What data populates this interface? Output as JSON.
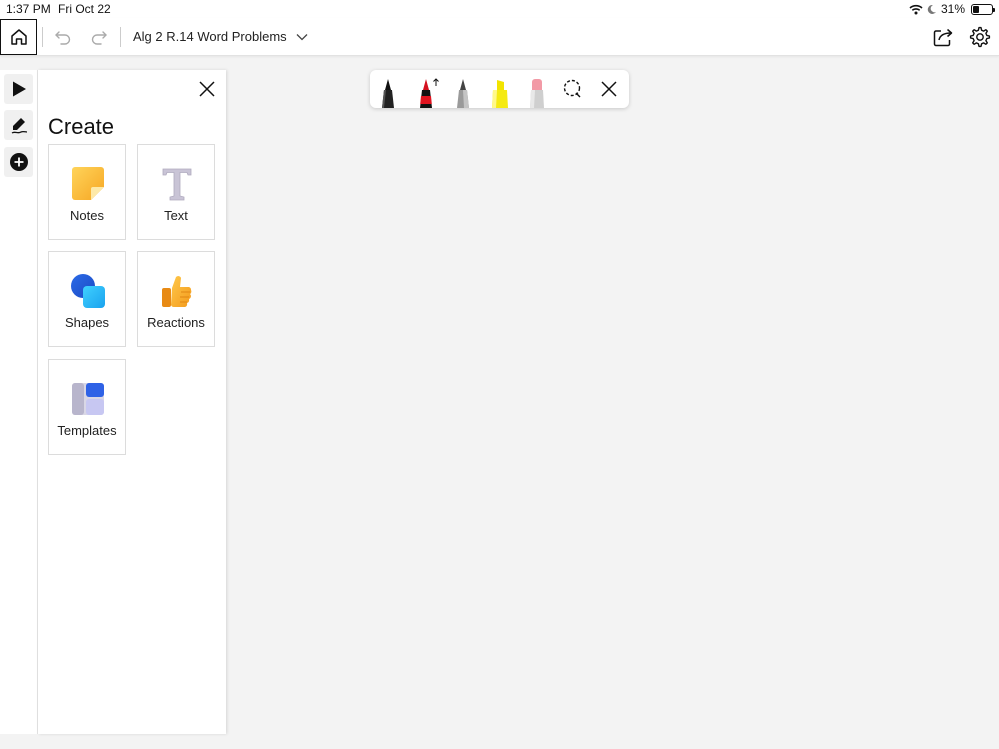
{
  "status": {
    "time": "1:37 PM",
    "date": "Fri Oct 22",
    "battery": "31%",
    "battery_level": 0.31
  },
  "toolbar": {
    "board_title": "Alg 2 R.14 Word Problems"
  },
  "create_panel": {
    "title": "Create",
    "tiles": [
      {
        "label": "Notes",
        "icon": "sticky-note-icon"
      },
      {
        "label": "Text",
        "icon": "text-icon"
      },
      {
        "label": "Shapes",
        "icon": "shapes-icon"
      },
      {
        "label": "Reactions",
        "icon": "thumbs-up-icon"
      },
      {
        "label": "Templates",
        "icon": "templates-icon"
      }
    ]
  },
  "ink_toolbar": {
    "tools": [
      "black-pen-icon",
      "red-pen-icon",
      "pencil-icon",
      "highlighter-icon",
      "eraser-icon",
      "lasso-icon",
      "close-icon"
    ]
  },
  "colors": {
    "accent": "#1f6fe0",
    "canvas": "#f3f3f3"
  }
}
